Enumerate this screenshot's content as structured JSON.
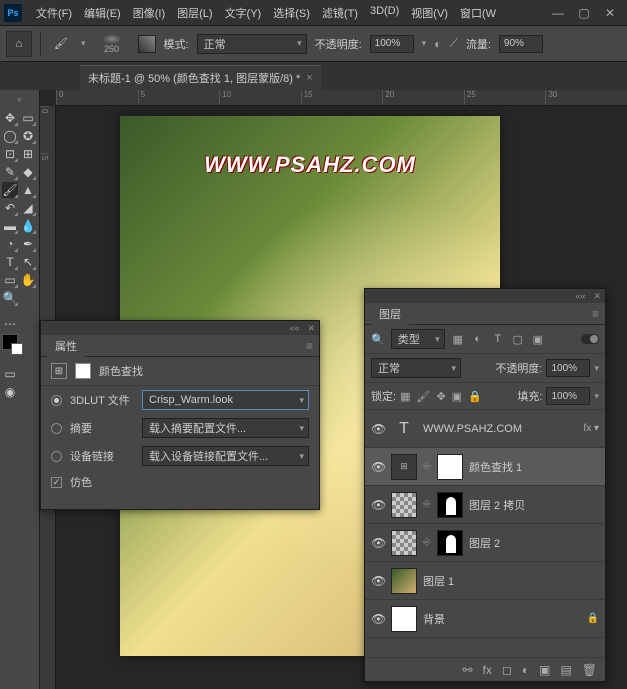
{
  "app": {
    "logo": "Ps"
  },
  "menu": [
    "文件(F)",
    "编辑(E)",
    "图像(I)",
    "图层(L)",
    "文字(Y)",
    "选择(S)",
    "滤镜(T)",
    "3D(D)",
    "视图(V)",
    "窗口(W"
  ],
  "options": {
    "brush_size": "250",
    "mode_label": "模式:",
    "mode_value": "正常",
    "opacity_label": "不透明度:",
    "opacity_value": "100%",
    "flow_label": "流量:",
    "flow_value": "90%"
  },
  "doc_tab": "未标题-1 @ 50% (颜色查找 1, 图层蒙版/8) *",
  "ruler_marks": [
    "0",
    "5",
    "10",
    "15",
    "20",
    "25",
    "30"
  ],
  "ruler_v": [
    "0",
    "5"
  ],
  "watermark": "WWW.PSAHZ.COM",
  "props": {
    "title": "属性",
    "header": "颜色查找",
    "lut_label": "3DLUT 文件",
    "lut_value": "Crisp_Warm.look",
    "abstract_label": "摘要",
    "abstract_value": "载入摘要配置文件...",
    "device_label": "设备链接",
    "device_value": "载入设备链接配置文件...",
    "dither_label": "仿色"
  },
  "layers": {
    "title": "图层",
    "filter_value": "类型",
    "blend_value": "正常",
    "opacity_label": "不透明度:",
    "opacity_value": "100%",
    "lock_label": "锁定:",
    "fill_label": "填充:",
    "fill_value": "100%",
    "rows": [
      {
        "icon": "T",
        "name": "WWW.PSAHZ.COM",
        "fx": "fx ▾"
      },
      {
        "icon": "adj",
        "mask": true,
        "name": "颜色查找 1",
        "selected": true
      },
      {
        "thumb": "checker",
        "mask": true,
        "name": "图层 2 拷贝"
      },
      {
        "thumb": "checker",
        "mask": true,
        "name": "图层 2"
      },
      {
        "thumb": "img",
        "name": "图层 1"
      },
      {
        "thumb": "white",
        "name": "背景",
        "locked": true
      }
    ]
  }
}
